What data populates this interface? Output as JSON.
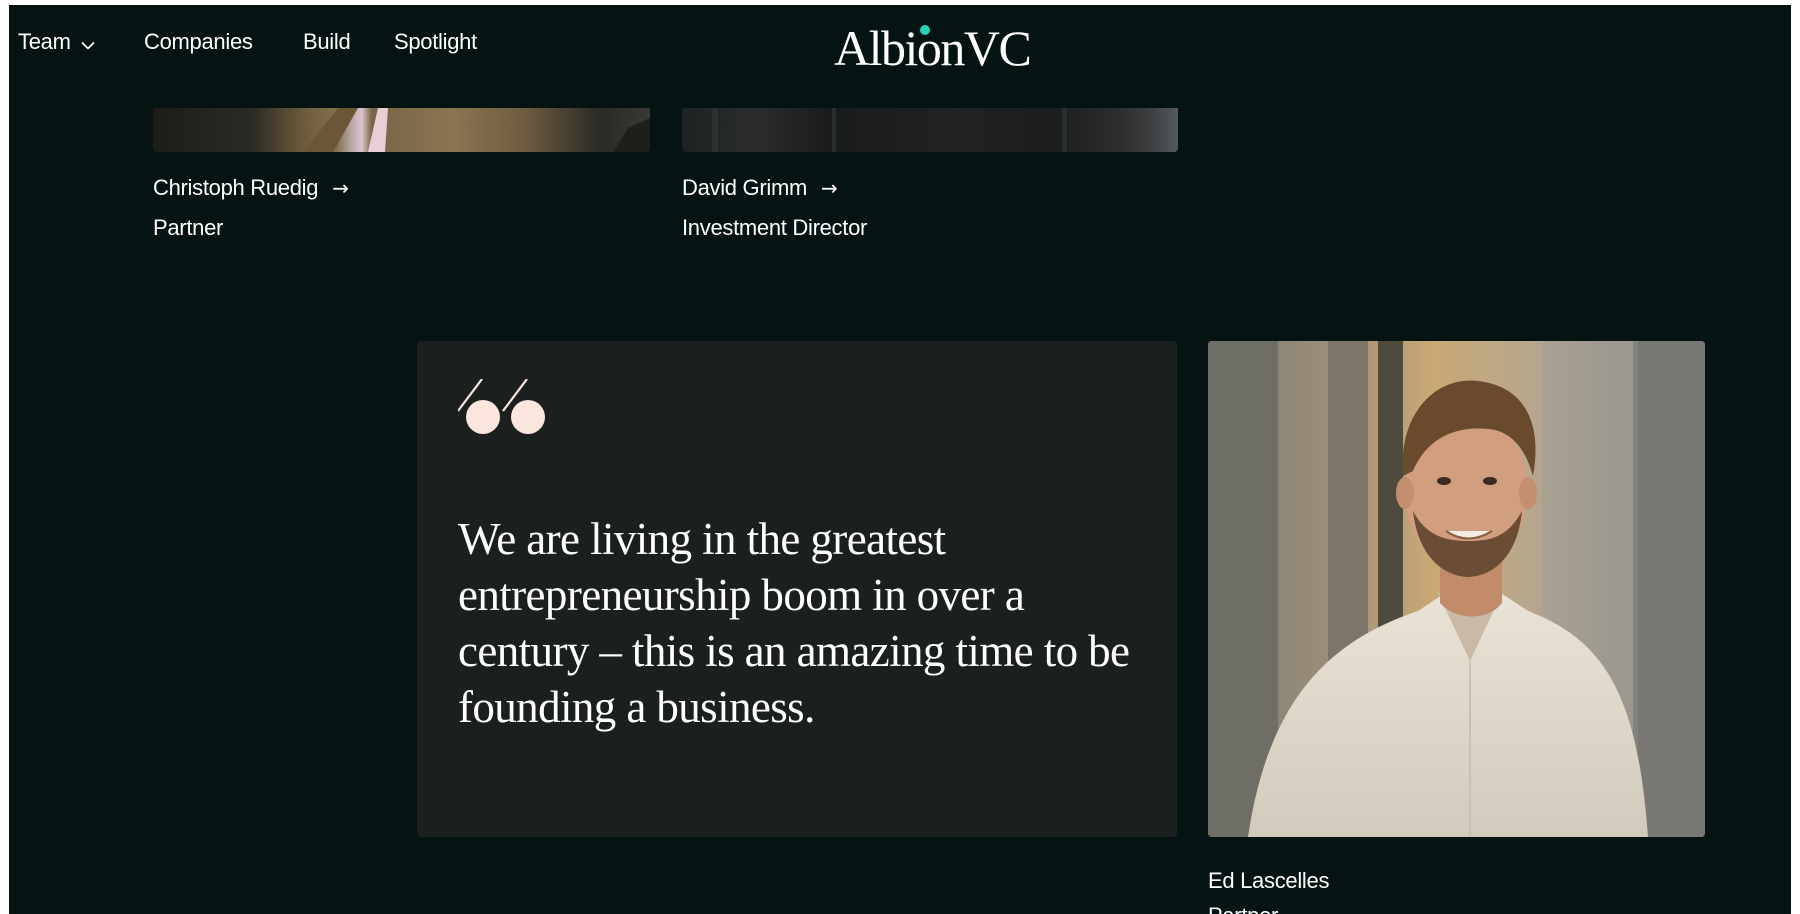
{
  "nav": {
    "team_label": "Team",
    "companies_label": "Companies",
    "build_label": "Build",
    "spotlight_label": "Spotlight",
    "logo_text": "AlbionVC",
    "logo_dot_color": "#26d4b4"
  },
  "team_members": [
    {
      "name": "Christoph Ruedig",
      "role": "Partner",
      "icon": "arrow-right-icon"
    },
    {
      "name": "David Grimm",
      "role": "Investment Director",
      "icon": "arrow-right-icon"
    }
  ],
  "quote": {
    "icon": "quote-marks-icon",
    "text": "We are living in the greatest entrepreneurship boom in over a century – this is an amazing time to be founding a business."
  },
  "featured": {
    "name": "Ed Lascelles",
    "role_partial": "Partner",
    "icon": "arrow-right-icon"
  },
  "colors": {
    "background": "#051312",
    "card": "#1b201f",
    "text": "#ffffff",
    "quote_icon": "#fbe6dd"
  }
}
